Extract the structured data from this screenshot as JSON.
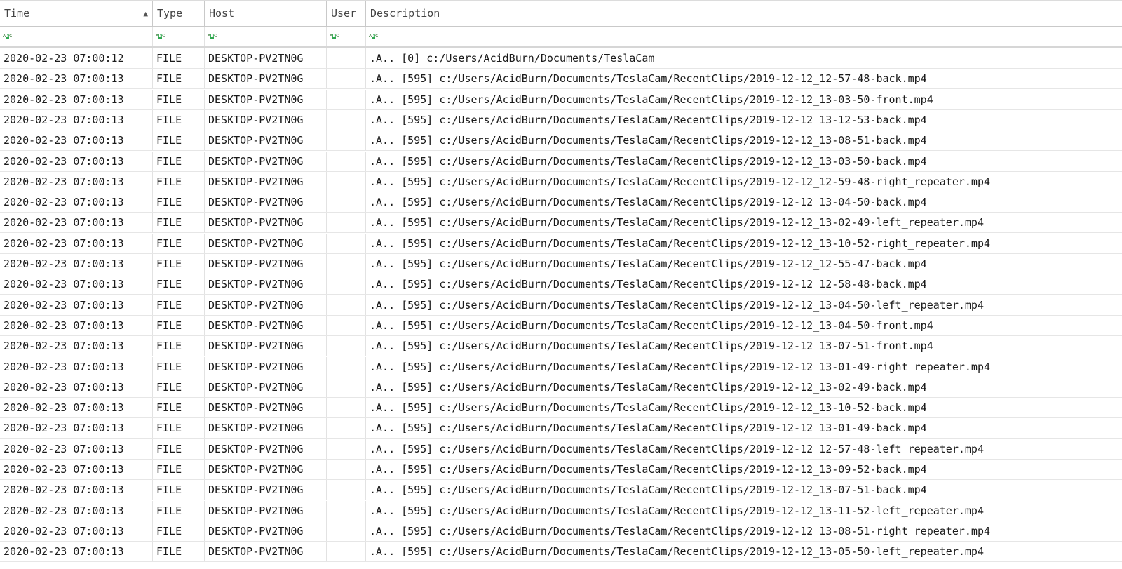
{
  "columns": {
    "time": "Time",
    "type": "Type",
    "host": "Host",
    "user": "User",
    "description": "Description"
  },
  "sort": {
    "column": "time",
    "direction": "ascending",
    "icon": "triangle-up-icon"
  },
  "filter_icon": "abc-text-filter-icon",
  "rows": [
    {
      "time": "2020-02-23 07:00:12",
      "type": "FILE",
      "host": "DESKTOP-PV2TN0G",
      "user": "",
      "description": ".A.. [0] c:/Users/AcidBurn/Documents/TeslaCam"
    },
    {
      "time": "2020-02-23 07:00:13",
      "type": "FILE",
      "host": "DESKTOP-PV2TN0G",
      "user": "",
      "description": ".A.. [595] c:/Users/AcidBurn/Documents/TeslaCam/RecentClips/2019-12-12_12-57-48-back.mp4"
    },
    {
      "time": "2020-02-23 07:00:13",
      "type": "FILE",
      "host": "DESKTOP-PV2TN0G",
      "user": "",
      "description": ".A.. [595] c:/Users/AcidBurn/Documents/TeslaCam/RecentClips/2019-12-12_13-03-50-front.mp4"
    },
    {
      "time": "2020-02-23 07:00:13",
      "type": "FILE",
      "host": "DESKTOP-PV2TN0G",
      "user": "",
      "description": ".A.. [595] c:/Users/AcidBurn/Documents/TeslaCam/RecentClips/2019-12-12_13-12-53-back.mp4"
    },
    {
      "time": "2020-02-23 07:00:13",
      "type": "FILE",
      "host": "DESKTOP-PV2TN0G",
      "user": "",
      "description": ".A.. [595] c:/Users/AcidBurn/Documents/TeslaCam/RecentClips/2019-12-12_13-08-51-back.mp4"
    },
    {
      "time": "2020-02-23 07:00:13",
      "type": "FILE",
      "host": "DESKTOP-PV2TN0G",
      "user": "",
      "description": ".A.. [595] c:/Users/AcidBurn/Documents/TeslaCam/RecentClips/2019-12-12_13-03-50-back.mp4"
    },
    {
      "time": "2020-02-23 07:00:13",
      "type": "FILE",
      "host": "DESKTOP-PV2TN0G",
      "user": "",
      "description": ".A.. [595] c:/Users/AcidBurn/Documents/TeslaCam/RecentClips/2019-12-12_12-59-48-right_repeater.mp4"
    },
    {
      "time": "2020-02-23 07:00:13",
      "type": "FILE",
      "host": "DESKTOP-PV2TN0G",
      "user": "",
      "description": ".A.. [595] c:/Users/AcidBurn/Documents/TeslaCam/RecentClips/2019-12-12_13-04-50-back.mp4"
    },
    {
      "time": "2020-02-23 07:00:13",
      "type": "FILE",
      "host": "DESKTOP-PV2TN0G",
      "user": "",
      "description": ".A.. [595] c:/Users/AcidBurn/Documents/TeslaCam/RecentClips/2019-12-12_13-02-49-left_repeater.mp4"
    },
    {
      "time": "2020-02-23 07:00:13",
      "type": "FILE",
      "host": "DESKTOP-PV2TN0G",
      "user": "",
      "description": ".A.. [595] c:/Users/AcidBurn/Documents/TeslaCam/RecentClips/2019-12-12_13-10-52-right_repeater.mp4"
    },
    {
      "time": "2020-02-23 07:00:13",
      "type": "FILE",
      "host": "DESKTOP-PV2TN0G",
      "user": "",
      "description": ".A.. [595] c:/Users/AcidBurn/Documents/TeslaCam/RecentClips/2019-12-12_12-55-47-back.mp4"
    },
    {
      "time": "2020-02-23 07:00:13",
      "type": "FILE",
      "host": "DESKTOP-PV2TN0G",
      "user": "",
      "description": ".A.. [595] c:/Users/AcidBurn/Documents/TeslaCam/RecentClips/2019-12-12_12-58-48-back.mp4"
    },
    {
      "time": "2020-02-23 07:00:13",
      "type": "FILE",
      "host": "DESKTOP-PV2TN0G",
      "user": "",
      "description": ".A.. [595] c:/Users/AcidBurn/Documents/TeslaCam/RecentClips/2019-12-12_13-04-50-left_repeater.mp4"
    },
    {
      "time": "2020-02-23 07:00:13",
      "type": "FILE",
      "host": "DESKTOP-PV2TN0G",
      "user": "",
      "description": ".A.. [595] c:/Users/AcidBurn/Documents/TeslaCam/RecentClips/2019-12-12_13-04-50-front.mp4"
    },
    {
      "time": "2020-02-23 07:00:13",
      "type": "FILE",
      "host": "DESKTOP-PV2TN0G",
      "user": "",
      "description": ".A.. [595] c:/Users/AcidBurn/Documents/TeslaCam/RecentClips/2019-12-12_13-07-51-front.mp4"
    },
    {
      "time": "2020-02-23 07:00:13",
      "type": "FILE",
      "host": "DESKTOP-PV2TN0G",
      "user": "",
      "description": ".A.. [595] c:/Users/AcidBurn/Documents/TeslaCam/RecentClips/2019-12-12_13-01-49-right_repeater.mp4"
    },
    {
      "time": "2020-02-23 07:00:13",
      "type": "FILE",
      "host": "DESKTOP-PV2TN0G",
      "user": "",
      "description": ".A.. [595] c:/Users/AcidBurn/Documents/TeslaCam/RecentClips/2019-12-12_13-02-49-back.mp4"
    },
    {
      "time": "2020-02-23 07:00:13",
      "type": "FILE",
      "host": "DESKTOP-PV2TN0G",
      "user": "",
      "description": ".A.. [595] c:/Users/AcidBurn/Documents/TeslaCam/RecentClips/2019-12-12_13-10-52-back.mp4"
    },
    {
      "time": "2020-02-23 07:00:13",
      "type": "FILE",
      "host": "DESKTOP-PV2TN0G",
      "user": "",
      "description": ".A.. [595] c:/Users/AcidBurn/Documents/TeslaCam/RecentClips/2019-12-12_13-01-49-back.mp4"
    },
    {
      "time": "2020-02-23 07:00:13",
      "type": "FILE",
      "host": "DESKTOP-PV2TN0G",
      "user": "",
      "description": ".A.. [595] c:/Users/AcidBurn/Documents/TeslaCam/RecentClips/2019-12-12_12-57-48-left_repeater.mp4"
    },
    {
      "time": "2020-02-23 07:00:13",
      "type": "FILE",
      "host": "DESKTOP-PV2TN0G",
      "user": "",
      "description": ".A.. [595] c:/Users/AcidBurn/Documents/TeslaCam/RecentClips/2019-12-12_13-09-52-back.mp4"
    },
    {
      "time": "2020-02-23 07:00:13",
      "type": "FILE",
      "host": "DESKTOP-PV2TN0G",
      "user": "",
      "description": ".A.. [595] c:/Users/AcidBurn/Documents/TeslaCam/RecentClips/2019-12-12_13-07-51-back.mp4"
    },
    {
      "time": "2020-02-23 07:00:13",
      "type": "FILE",
      "host": "DESKTOP-PV2TN0G",
      "user": "",
      "description": ".A.. [595] c:/Users/AcidBurn/Documents/TeslaCam/RecentClips/2019-12-12_13-11-52-left_repeater.mp4"
    },
    {
      "time": "2020-02-23 07:00:13",
      "type": "FILE",
      "host": "DESKTOP-PV2TN0G",
      "user": "",
      "description": ".A.. [595] c:/Users/AcidBurn/Documents/TeslaCam/RecentClips/2019-12-12_13-08-51-right_repeater.mp4"
    },
    {
      "time": "2020-02-23 07:00:13",
      "type": "FILE",
      "host": "DESKTOP-PV2TN0G",
      "user": "",
      "description": ".A.. [595] c:/Users/AcidBurn/Documents/TeslaCam/RecentClips/2019-12-12_13-05-50-left_repeater.mp4"
    }
  ]
}
